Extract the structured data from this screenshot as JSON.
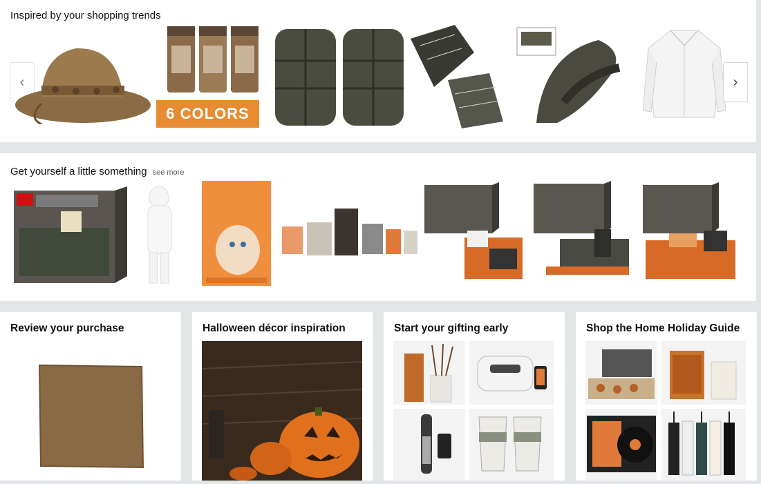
{
  "row1": {
    "title": "Inspired by your shopping trends",
    "badge_text": "6 COLORS",
    "left_arrow": "‹",
    "right_arrow": "›"
  },
  "row2": {
    "title": "Get yourself a little something",
    "see_more": "see more"
  },
  "cards": [
    {
      "title": "Review your purchase"
    },
    {
      "title": "Halloween décor inspiration"
    },
    {
      "title": "Start your gifting early"
    },
    {
      "title": "Shop the Home Holiday Guide"
    }
  ],
  "colors": {
    "accent_orange": "#e98b30",
    "page_bg": "#e3e6e6"
  }
}
